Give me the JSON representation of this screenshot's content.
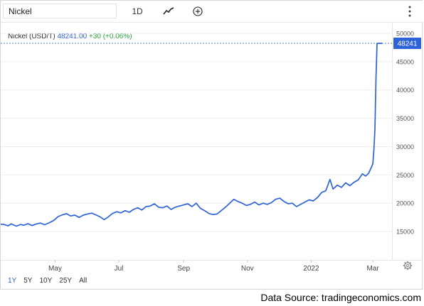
{
  "toolbar": {
    "symbol": "Nickel",
    "interval": "1D",
    "chart_type_icon": "line-chart-icon",
    "compare_icon": "plus-circle-icon",
    "more_icon": "vertical-dots-icon"
  },
  "legend": {
    "name": "Nickel (USD/T)",
    "price": "48241.00",
    "change": "+30 (+0.06%)"
  },
  "price_label": "48241",
  "ranges": [
    {
      "label": "1Y",
      "active": true
    },
    {
      "label": "5Y",
      "active": false
    },
    {
      "label": "10Y",
      "active": false
    },
    {
      "label": "25Y",
      "active": false
    },
    {
      "label": "All",
      "active": false
    }
  ],
  "source": "Data Source: tradingeconomics.com",
  "colors": {
    "line": "#2e62d9",
    "positive": "#2aa33a",
    "grid": "#eeeeee"
  },
  "chart_data": {
    "type": "line",
    "title": "",
    "xlabel": "",
    "ylabel": "",
    "ylim": [
      10000,
      52000
    ],
    "yticks": [
      15000,
      20000,
      25000,
      30000,
      35000,
      40000,
      45000,
      50000
    ],
    "xlim": [
      "2021-03-10",
      "2022-03-20"
    ],
    "xticks": [
      {
        "date": "2021-05-01",
        "label": "May"
      },
      {
        "date": "2021-07-01",
        "label": "Jul"
      },
      {
        "date": "2021-09-01",
        "label": "Sep"
      },
      {
        "date": "2021-11-01",
        "label": "Nov"
      },
      {
        "date": "2022-01-01",
        "label": "2022"
      },
      {
        "date": "2022-03-01",
        "label": "Mar"
      }
    ],
    "last_value": 48241,
    "series": [
      {
        "values": [
          [
            "2021-03-10",
            16300
          ],
          [
            "2021-03-13",
            16250
          ],
          [
            "2021-03-17",
            16000
          ],
          [
            "2021-03-20",
            16350
          ],
          [
            "2021-03-25",
            15950
          ],
          [
            "2021-03-29",
            16250
          ],
          [
            "2021-04-01",
            16100
          ],
          [
            "2021-04-05",
            16400
          ],
          [
            "2021-04-09",
            16050
          ],
          [
            "2021-04-13",
            16350
          ],
          [
            "2021-04-17",
            16500
          ],
          [
            "2021-04-21",
            16200
          ],
          [
            "2021-04-26",
            16600
          ],
          [
            "2021-04-30",
            17000
          ],
          [
            "2021-05-04",
            17650
          ],
          [
            "2021-05-08",
            17950
          ],
          [
            "2021-05-12",
            18150
          ],
          [
            "2021-05-16",
            17750
          ],
          [
            "2021-05-20",
            17900
          ],
          [
            "2021-05-24",
            17500
          ],
          [
            "2021-05-28",
            17900
          ],
          [
            "2021-06-01",
            18100
          ],
          [
            "2021-06-05",
            18250
          ],
          [
            "2021-06-09",
            17950
          ],
          [
            "2021-06-13",
            17600
          ],
          [
            "2021-06-17",
            17100
          ],
          [
            "2021-06-21",
            17600
          ],
          [
            "2021-06-25",
            18200
          ],
          [
            "2021-06-29",
            18500
          ],
          [
            "2021-07-03",
            18300
          ],
          [
            "2021-07-07",
            18700
          ],
          [
            "2021-07-11",
            18400
          ],
          [
            "2021-07-15",
            18900
          ],
          [
            "2021-07-19",
            19200
          ],
          [
            "2021-07-23",
            18800
          ],
          [
            "2021-07-27",
            19400
          ],
          [
            "2021-07-31",
            19500
          ],
          [
            "2021-08-04",
            19900
          ],
          [
            "2021-08-08",
            19300
          ],
          [
            "2021-08-12",
            19200
          ],
          [
            "2021-08-16",
            19500
          ],
          [
            "2021-08-20",
            18900
          ],
          [
            "2021-08-24",
            19300
          ],
          [
            "2021-08-28",
            19500
          ],
          [
            "2021-09-01",
            19700
          ],
          [
            "2021-09-05",
            19900
          ],
          [
            "2021-09-09",
            19400
          ],
          [
            "2021-09-13",
            20000
          ],
          [
            "2021-09-17",
            19100
          ],
          [
            "2021-09-21",
            18700
          ],
          [
            "2021-09-25",
            18200
          ],
          [
            "2021-09-29",
            18000
          ],
          [
            "2021-10-03",
            18100
          ],
          [
            "2021-10-07",
            18700
          ],
          [
            "2021-10-11",
            19300
          ],
          [
            "2021-10-15",
            20000
          ],
          [
            "2021-10-19",
            20700
          ],
          [
            "2021-10-23",
            20300
          ],
          [
            "2021-10-27",
            20000
          ],
          [
            "2021-10-31",
            19600
          ],
          [
            "2021-11-04",
            19800
          ],
          [
            "2021-11-08",
            20200
          ],
          [
            "2021-11-12",
            19700
          ],
          [
            "2021-11-16",
            20000
          ],
          [
            "2021-11-20",
            19800
          ],
          [
            "2021-11-24",
            20100
          ],
          [
            "2021-11-28",
            20700
          ],
          [
            "2021-12-02",
            20900
          ],
          [
            "2021-12-06",
            20300
          ],
          [
            "2021-12-10",
            19900
          ],
          [
            "2021-12-14",
            20000
          ],
          [
            "2021-12-18",
            19400
          ],
          [
            "2021-12-22",
            19800
          ],
          [
            "2021-12-26",
            20200
          ],
          [
            "2021-12-30",
            20600
          ],
          [
            "2022-01-03",
            20400
          ],
          [
            "2022-01-07",
            21000
          ],
          [
            "2022-01-11",
            21900
          ],
          [
            "2022-01-15",
            22200
          ],
          [
            "2022-01-19",
            24200
          ],
          [
            "2022-01-22",
            22500
          ],
          [
            "2022-01-26",
            23200
          ],
          [
            "2022-01-30",
            22800
          ],
          [
            "2022-02-03",
            23600
          ],
          [
            "2022-02-07",
            23100
          ],
          [
            "2022-02-11",
            23700
          ],
          [
            "2022-02-15",
            24100
          ],
          [
            "2022-02-19",
            25200
          ],
          [
            "2022-02-22",
            24800
          ],
          [
            "2022-02-25",
            25300
          ],
          [
            "2022-02-28",
            26500
          ],
          [
            "2022-03-01",
            27000
          ],
          [
            "2022-03-02",
            29500
          ],
          [
            "2022-03-03",
            33000
          ],
          [
            "2022-03-04",
            42000
          ],
          [
            "2022-03-05",
            48211
          ],
          [
            "2022-03-08",
            48241
          ],
          [
            "2022-03-10",
            48241
          ]
        ]
      }
    ]
  }
}
